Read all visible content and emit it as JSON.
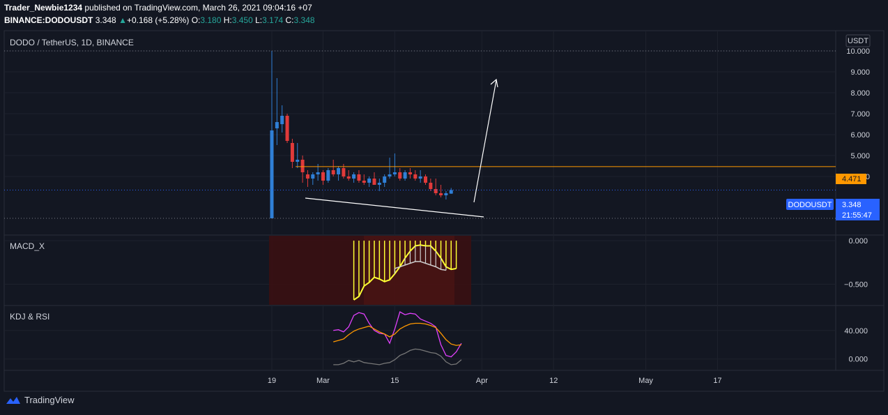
{
  "publish": {
    "author": "Trader_Newbie1234",
    "text": " published on TradingView.com, March 26, 2021 09:04:16 +07"
  },
  "quote": {
    "symbol": "BINANCE:DODOUSDT",
    "last": "3.348",
    "change": "+0.168 (+5.28%)",
    "o_label": "O:",
    "o": "3.180",
    "h_label": "H:",
    "h": "3.450",
    "l_label": "L:",
    "l": "3.174",
    "c_label": "C:",
    "c": "3.348"
  },
  "main_pane": {
    "title": "DODO / TetherUS, 1D, BINANCE",
    "currency_badge": "USDT",
    "symbol_tag": "DODOUSDT",
    "price_tag": "3.348",
    "countdown": "21:55:47",
    "level_tag": "4.471"
  },
  "colors": {
    "background": "#131722",
    "up": "#2f7fd6",
    "down": "#e03a3a",
    "level": "#ff9800",
    "price_tag": "#2962ff",
    "macd_fill": "#ffff33",
    "k_line": "#e040fb",
    "d_line": "#ff9800",
    "rsi_line": "#777777"
  },
  "chart_data": [
    {
      "type": "candlestick",
      "title": "DODO / TetherUS, 1D, BINANCE",
      "y_ticks": [
        "10.000",
        "9.000",
        "8.000",
        "7.000",
        "6.000",
        "5.000",
        "4.000"
      ],
      "y_tick_values": [
        10,
        9,
        8,
        7,
        6,
        5,
        4
      ],
      "ylim": [
        1.9,
        10.1
      ],
      "x_ticks": [
        "19",
        "Mar",
        "15",
        "Apr",
        "12",
        "May",
        "17"
      ],
      "x_tick_day_index": [
        0,
        10,
        24,
        41,
        55,
        73,
        87
      ],
      "horizontal_level": 4.471,
      "last_price": 3.348,
      "candles": [
        {
          "o": 2.0,
          "h": 10.0,
          "l": 2.0,
          "c": 6.2
        },
        {
          "o": 6.3,
          "h": 8.7,
          "l": 5.5,
          "c": 6.6
        },
        {
          "o": 6.5,
          "h": 7.4,
          "l": 6.1,
          "c": 6.9
        },
        {
          "o": 6.9,
          "h": 7.0,
          "l": 5.6,
          "c": 5.7
        },
        {
          "o": 5.6,
          "h": 5.8,
          "l": 4.4,
          "c": 4.7
        },
        {
          "o": 4.7,
          "h": 5.6,
          "l": 4.4,
          "c": 4.8
        },
        {
          "o": 4.8,
          "h": 5.0,
          "l": 3.7,
          "c": 4.2
        },
        {
          "o": 4.1,
          "h": 4.3,
          "l": 3.5,
          "c": 3.9
        },
        {
          "o": 3.9,
          "h": 4.2,
          "l": 3.6,
          "c": 4.1
        },
        {
          "o": 4.1,
          "h": 4.6,
          "l": 3.8,
          "c": 4.2
        },
        {
          "o": 4.2,
          "h": 4.3,
          "l": 3.6,
          "c": 3.8
        },
        {
          "o": 3.8,
          "h": 4.4,
          "l": 3.7,
          "c": 4.3
        },
        {
          "o": 4.3,
          "h": 4.8,
          "l": 4.0,
          "c": 4.1
        },
        {
          "o": 4.1,
          "h": 4.5,
          "l": 3.8,
          "c": 4.4
        },
        {
          "o": 4.4,
          "h": 4.6,
          "l": 3.9,
          "c": 4.0
        },
        {
          "o": 4.0,
          "h": 4.3,
          "l": 3.8,
          "c": 3.9
        },
        {
          "o": 3.9,
          "h": 4.2,
          "l": 3.7,
          "c": 4.1
        },
        {
          "o": 4.1,
          "h": 4.3,
          "l": 3.7,
          "c": 3.8
        },
        {
          "o": 3.8,
          "h": 4.1,
          "l": 3.6,
          "c": 3.7
        },
        {
          "o": 3.7,
          "h": 4.0,
          "l": 3.5,
          "c": 3.9
        },
        {
          "o": 3.9,
          "h": 4.2,
          "l": 3.6,
          "c": 3.6
        },
        {
          "o": 3.6,
          "h": 3.9,
          "l": 3.3,
          "c": 3.7
        },
        {
          "o": 3.7,
          "h": 4.1,
          "l": 3.5,
          "c": 4.0
        },
        {
          "o": 4.0,
          "h": 4.9,
          "l": 3.9,
          "c": 4.1
        },
        {
          "o": 4.1,
          "h": 5.1,
          "l": 4.0,
          "c": 4.2
        },
        {
          "o": 4.2,
          "h": 4.4,
          "l": 3.8,
          "c": 3.9
        },
        {
          "o": 3.9,
          "h": 4.3,
          "l": 3.8,
          "c": 4.2
        },
        {
          "o": 4.2,
          "h": 4.4,
          "l": 3.9,
          "c": 4.1
        },
        {
          "o": 4.1,
          "h": 4.3,
          "l": 3.8,
          "c": 3.9
        },
        {
          "o": 3.9,
          "h": 4.3,
          "l": 3.7,
          "c": 4.0
        },
        {
          "o": 4.0,
          "h": 4.1,
          "l": 3.6,
          "c": 3.7
        },
        {
          "o": 3.7,
          "h": 3.9,
          "l": 3.3,
          "c": 3.4
        },
        {
          "o": 3.4,
          "h": 3.9,
          "l": 3.1,
          "c": 3.2
        },
        {
          "o": 3.2,
          "h": 3.6,
          "l": 3.0,
          "c": 3.1
        },
        {
          "o": 3.1,
          "h": 3.3,
          "l": 2.9,
          "c": 3.2
        },
        {
          "o": 3.18,
          "h": 3.45,
          "l": 3.17,
          "c": 3.35
        }
      ]
    },
    {
      "type": "bar",
      "title": "MACD_X",
      "y_ticks": [
        "0.000",
        "−0.500"
      ],
      "y_tick_values": [
        0,
        -0.5
      ],
      "ylim": [
        -0.72,
        0.04
      ],
      "start_day_index": 16,
      "values": [
        -0.68,
        -0.64,
        -0.52,
        -0.48,
        -0.42,
        -0.44,
        -0.47,
        -0.45,
        -0.38,
        -0.3,
        -0.2,
        -0.12,
        -0.06,
        -0.05,
        -0.06,
        -0.06,
        -0.12,
        -0.2,
        -0.3,
        -0.33,
        -0.32
      ],
      "signal_start_day_index": 24,
      "signal": [
        -0.32,
        -0.3,
        -0.28,
        -0.26,
        -0.24,
        -0.24,
        -0.26,
        -0.28,
        -0.3,
        -0.33,
        -0.34
      ]
    },
    {
      "type": "line",
      "title": "KDJ & RSI",
      "y_ticks": [
        "40.000",
        "0.000"
      ],
      "y_tick_values": [
        40,
        0
      ],
      "ylim": [
        -13,
        72
      ],
      "start_day_index": 12,
      "series": [
        {
          "values": [
            40,
            41,
            38,
            45,
            61,
            65,
            63,
            50,
            40,
            36,
            35,
            22,
            42,
            66,
            62,
            64,
            63,
            56,
            53,
            50,
            45,
            20,
            5,
            3,
            10,
            22
          ]
        },
        {
          "values": [
            24,
            26,
            28,
            34,
            39,
            42,
            44,
            46,
            42,
            38,
            35,
            31,
            35,
            42,
            46,
            49,
            50,
            50,
            49,
            47,
            44,
            36,
            27,
            21,
            19,
            20
          ]
        },
        {
          "values": [
            -8,
            -8,
            -6,
            -2,
            -4,
            -2,
            -5,
            -6,
            -7,
            -8,
            -6,
            -5,
            -1,
            5,
            8,
            12,
            14,
            13,
            11,
            9,
            8,
            4,
            -4,
            -8,
            -7,
            -1
          ]
        }
      ]
    }
  ],
  "footer": {
    "brand": "TradingView"
  }
}
